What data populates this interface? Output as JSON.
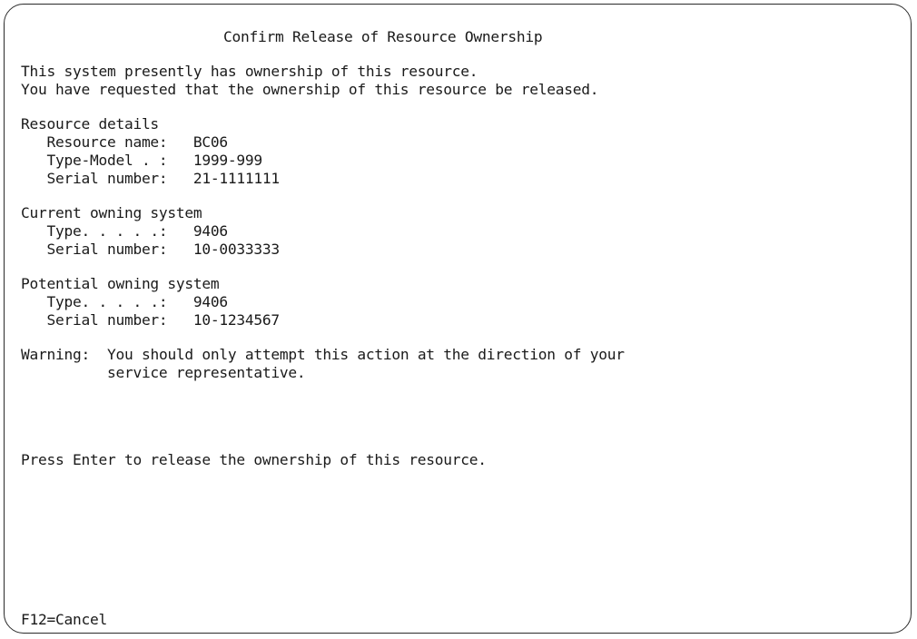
{
  "screen": {
    "title": "Confirm Release of Resource Ownership",
    "intro": [
      "This system presently has ownership of this resource.",
      "You have requested that the ownership of this resource be released."
    ],
    "resource": {
      "heading": "Resource details",
      "name_label": "   Resource name:   ",
      "name_value": "BC06",
      "type_model_label": "   Type-Model . :   ",
      "type_model_value": "1999-999",
      "serial_label": "   Serial number:   ",
      "serial_value": "21-1111111"
    },
    "current_owner": {
      "heading": "Current owning system",
      "type_label": "   Type. . . . .:   ",
      "type_value": "9406",
      "serial_label": "   Serial number:   ",
      "serial_value": "10-0033333"
    },
    "potential_owner": {
      "heading": "Potential owning system",
      "type_label": "   Type. . . . .:   ",
      "type_value": "9406",
      "serial_label": "   Serial number:   ",
      "serial_value": "10-1234567"
    },
    "warning": {
      "label": "Warning:  ",
      "line1": "You should only attempt this action at the direction of your",
      "line2": "          service representative."
    },
    "prompt": "Press Enter to release the ownership of this resource.",
    "function_keys": {
      "cancel": "F12=Cancel"
    }
  }
}
